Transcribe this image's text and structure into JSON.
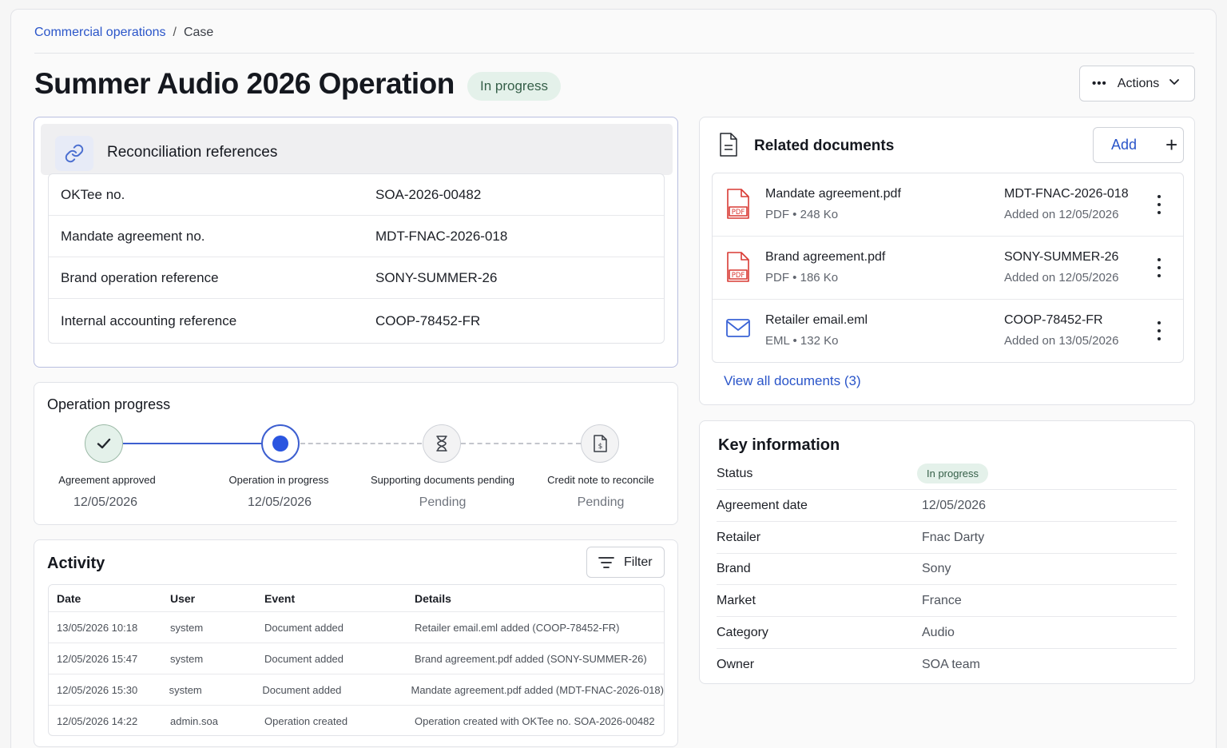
{
  "breadcrumb": {
    "parent": "Commercial operations",
    "separator": "/",
    "current": "Case"
  },
  "header": {
    "title": "Summer Audio 2026 Operation",
    "status": "In progress",
    "actions_label": "Actions"
  },
  "reconciliation": {
    "title": "Reconciliation references",
    "rows": [
      {
        "label": "OKTee no.",
        "value": "SOA-2026-00482"
      },
      {
        "label": "Mandate agreement no.",
        "value": "MDT-FNAC-2026-018"
      },
      {
        "label": "Brand operation reference",
        "value": "SONY-SUMMER-26"
      },
      {
        "label": "Internal accounting reference",
        "value": "COOP-78452-FR"
      }
    ]
  },
  "progress": {
    "title": "Operation progress",
    "steps": [
      {
        "label": "Agreement approved",
        "date": "12/05/2026",
        "state": "done"
      },
      {
        "label": "Operation in progress",
        "date": "12/05/2026",
        "state": "current"
      },
      {
        "label": "Supporting documents pending",
        "date": "Pending",
        "state": "pending"
      },
      {
        "label": "Credit note to reconcile",
        "date": "Pending",
        "state": "pending"
      }
    ]
  },
  "activity": {
    "title": "Activity",
    "filter_label": "Filter",
    "columns": [
      "Date",
      "User",
      "Event",
      "Details"
    ],
    "rows": [
      [
        "13/05/2026 10:18",
        "system",
        "Document added",
        "Retailer email.eml added (COOP-78452-FR)"
      ],
      [
        "12/05/2026 15:47",
        "system",
        "Document added",
        "Brand agreement.pdf added (SONY-SUMMER-26)"
      ],
      [
        "12/05/2026 15:30",
        "system",
        "Document added",
        "Mandate agreement.pdf added (MDT-FNAC-2026-018)"
      ],
      [
        "12/05/2026 14:22",
        "admin.soa",
        "Operation created",
        "Operation created with OKTee no. SOA-2026-00482"
      ]
    ]
  },
  "documents": {
    "title": "Related documents",
    "add_label": "Add",
    "items": [
      {
        "name": "Mandate agreement.pdf",
        "type": "PDF",
        "size": "248 Ko",
        "ref": "MDT-FNAC-2026-018",
        "added": "Added on 12/05/2026",
        "icon": "pdf-icon"
      },
      {
        "name": "Brand agreement.pdf",
        "type": "PDF",
        "size": "186 Ko",
        "ref": "SONY-SUMMER-26",
        "added": "Added on 12/05/2026",
        "icon": "pdf-icon"
      },
      {
        "name": "Retailer email.eml",
        "type": "EML",
        "size": "132 Ko",
        "ref": "COOP-78452-FR",
        "added": "Added on 13/05/2026",
        "icon": "mail-icon"
      }
    ],
    "view_all": "View all documents (3)",
    "meta_separator": "•",
    "pdf_badge": "PDF"
  },
  "key_info": {
    "title": "Key information",
    "rows": [
      {
        "label": "Status",
        "value": "In progress"
      },
      {
        "label": "Agreement date",
        "value": "12/05/2026"
      },
      {
        "label": "Retailer",
        "value": "Fnac Darty"
      },
      {
        "label": "Brand",
        "value": "Sony"
      },
      {
        "label": "Market",
        "value": "France"
      },
      {
        "label": "Category",
        "value": "Audio"
      },
      {
        "label": "Owner",
        "value": "SOA team"
      }
    ]
  },
  "colors": {
    "accent": "#2a55c9",
    "status_bg": "#e4f1ea",
    "status_text": "#355f48",
    "pdf_red": "#d93a34"
  }
}
